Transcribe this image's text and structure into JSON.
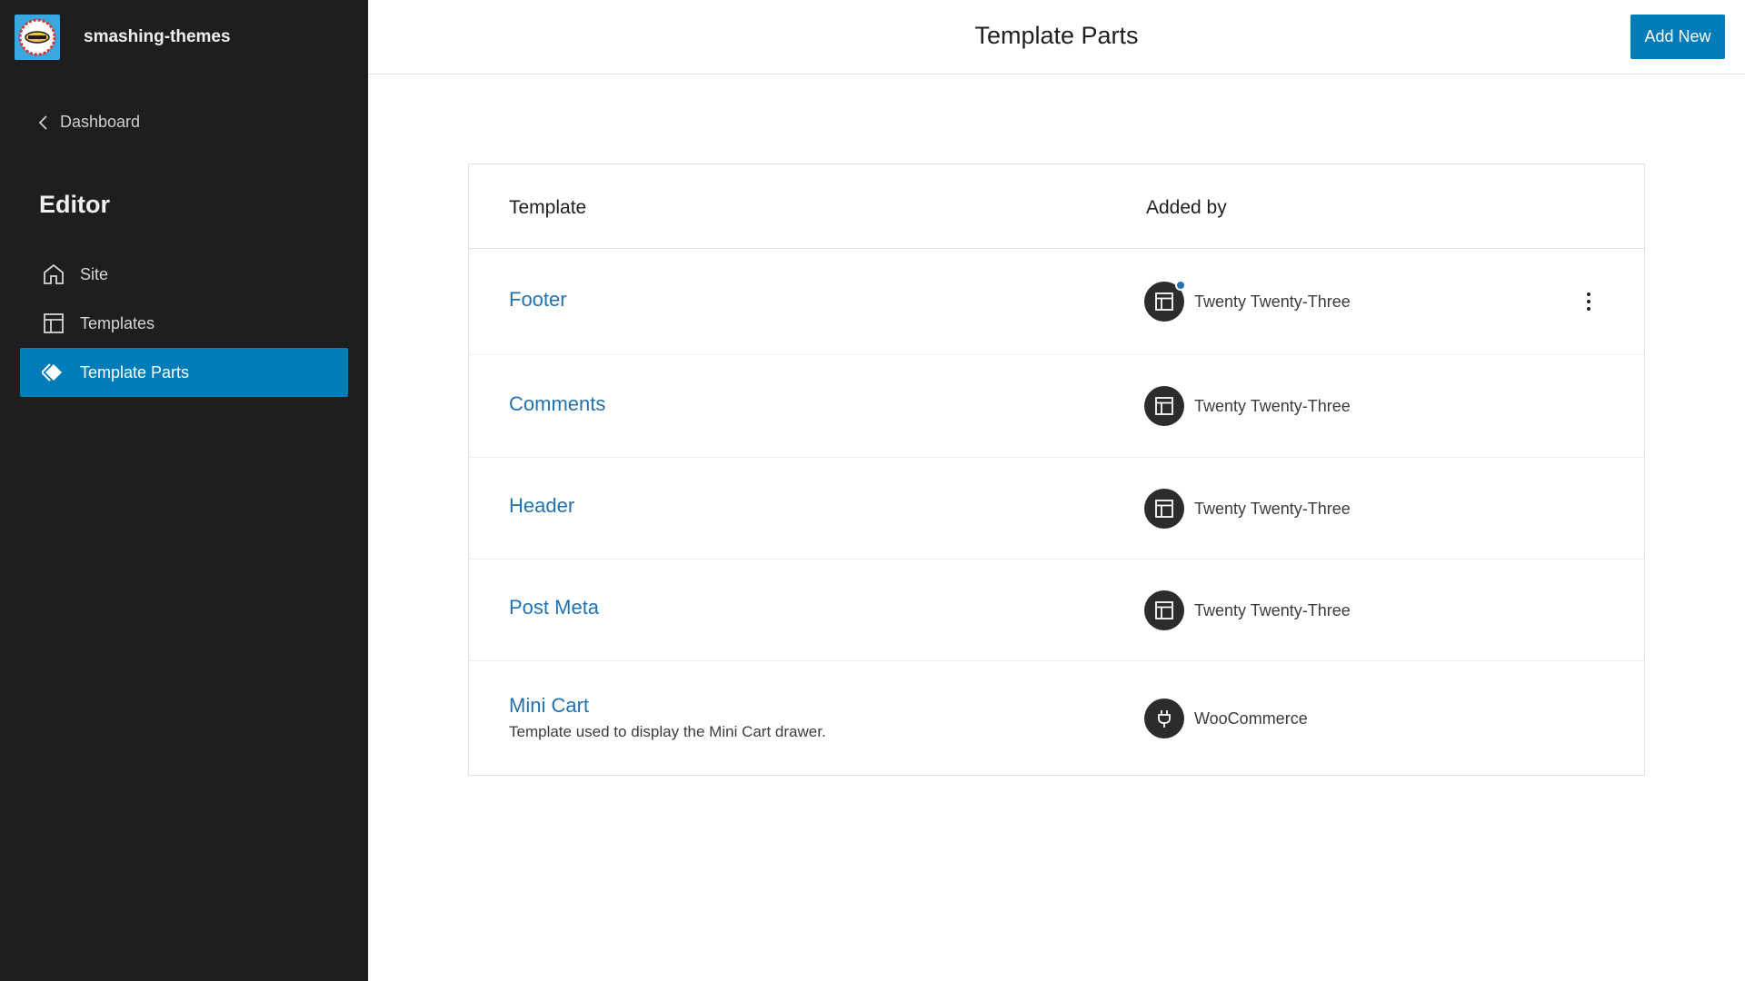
{
  "sidebar": {
    "site_name": "smashing-themes",
    "back_label": "Dashboard",
    "section_title": "Editor",
    "items": [
      {
        "label": "Site",
        "icon": "home-icon"
      },
      {
        "label": "Templates",
        "icon": "layout-icon"
      },
      {
        "label": "Template Parts",
        "icon": "symbol-filled-icon",
        "active": true
      }
    ]
  },
  "header": {
    "title": "Template Parts",
    "add_new_label": "Add New"
  },
  "table": {
    "columns": [
      "Template",
      "Added by"
    ],
    "rows": [
      {
        "title": "Footer",
        "description": "",
        "added_by": "Twenty Twenty-Three",
        "icon": "layout-icon",
        "has_update_dot": true,
        "has_more_menu": true
      },
      {
        "title": "Comments",
        "description": "",
        "added_by": "Twenty Twenty-Three",
        "icon": "layout-icon"
      },
      {
        "title": "Header",
        "description": "",
        "added_by": "Twenty Twenty-Three",
        "icon": "layout-icon"
      },
      {
        "title": "Post Meta",
        "description": "",
        "added_by": "Twenty Twenty-Three",
        "icon": "layout-icon"
      },
      {
        "title": "Mini Cart",
        "description": "Template used to display the Mini Cart drawer.",
        "added_by": "WooCommerce",
        "icon": "plugins-icon"
      }
    ]
  },
  "colors": {
    "sidebar_bg": "#1e1e1e",
    "accent": "#007cba",
    "link": "#2271b1"
  }
}
